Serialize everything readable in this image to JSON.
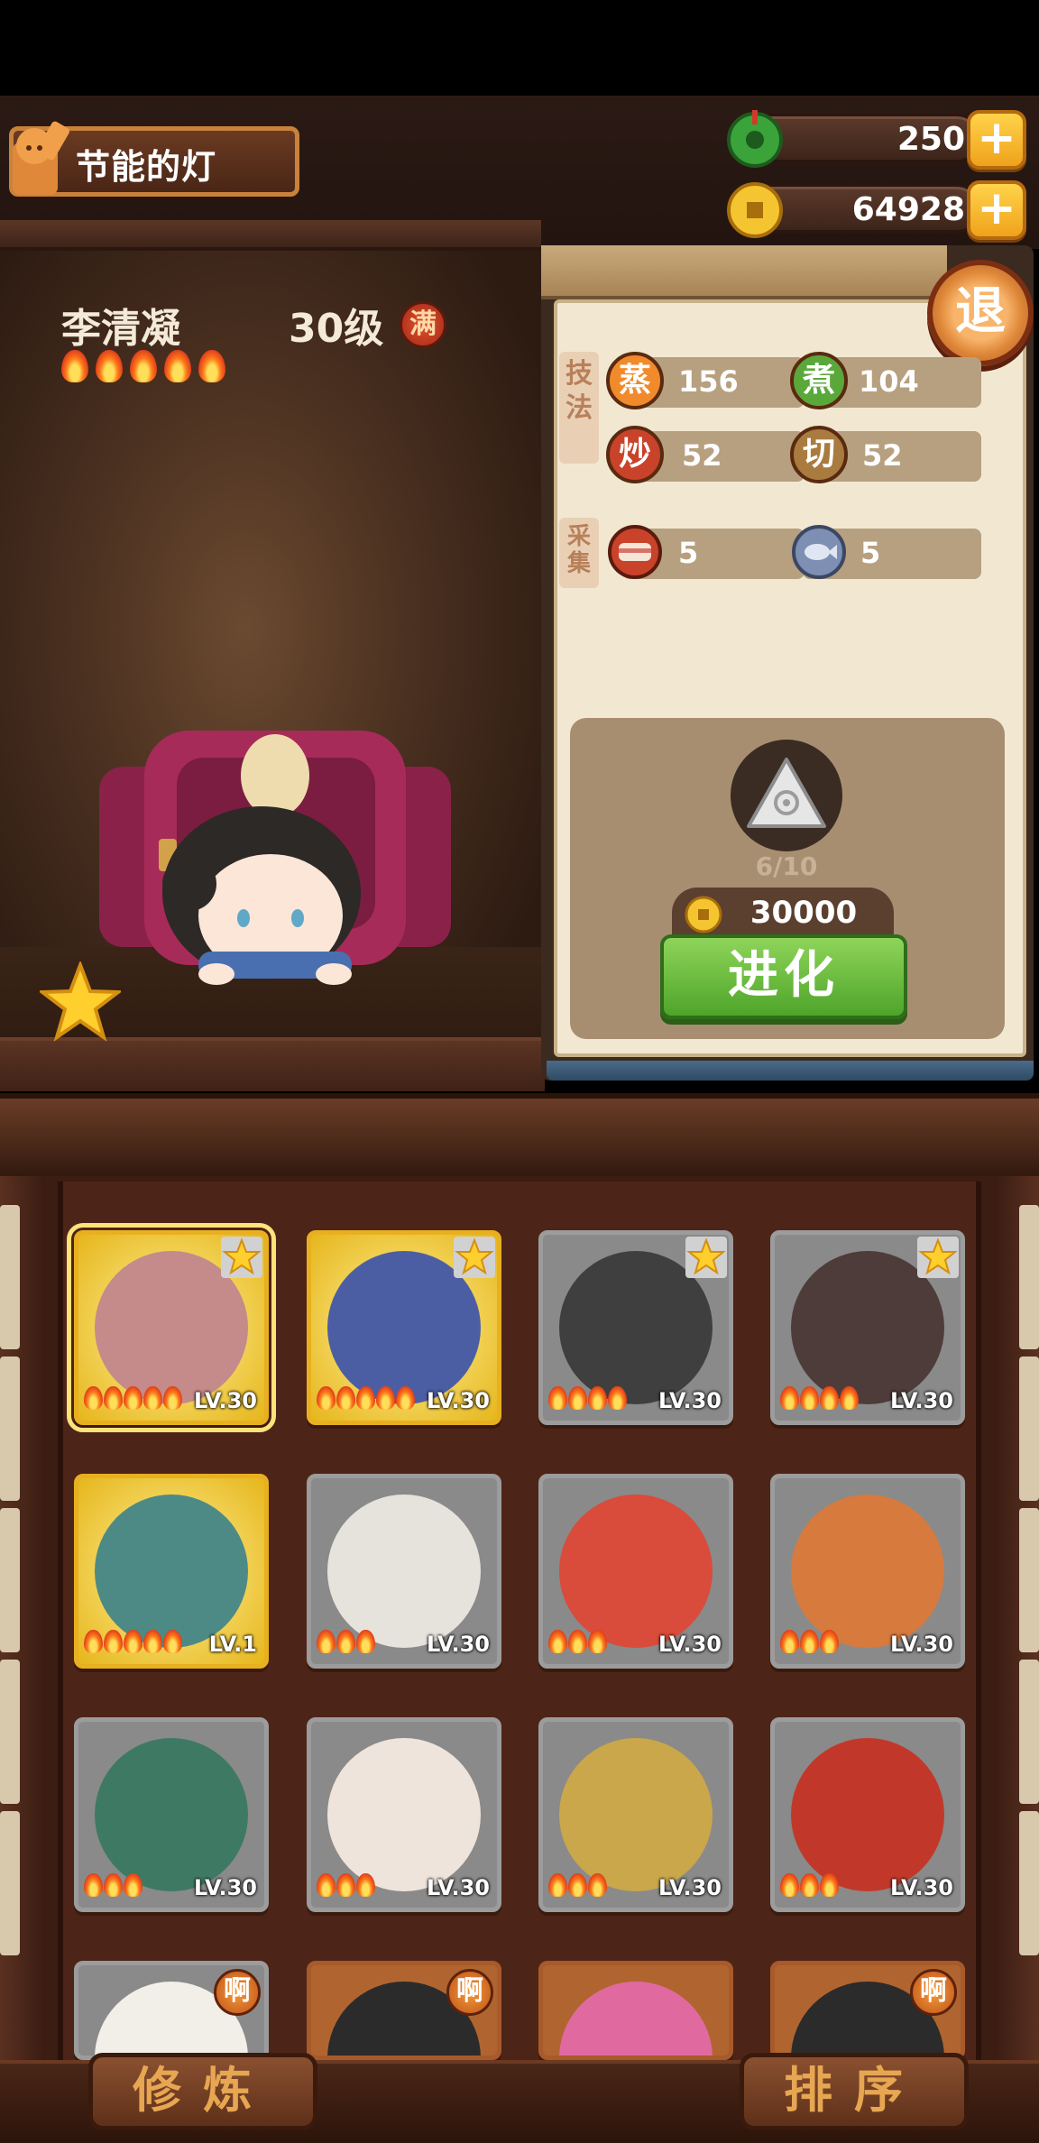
{
  "player": {
    "name": "节能的灯"
  },
  "currency": {
    "jade": {
      "value": "250",
      "add": "+"
    },
    "coins": {
      "value": "64928",
      "add": "+"
    }
  },
  "exit_label": "退",
  "character": {
    "name": "李清凝",
    "level": "30级",
    "max_badge": "满",
    "flames": 5
  },
  "stats": {
    "technique_label": "技法",
    "gather_label": "采集",
    "technique": [
      {
        "icon_label": "蒸",
        "value": "156",
        "color": "#f08a2a"
      },
      {
        "icon_label": "煮",
        "value": "104",
        "color": "#5aa83a"
      },
      {
        "icon_label": "炒",
        "value": "52",
        "color": "#c8432a"
      },
      {
        "icon_label": "切",
        "value": "52",
        "color": "#a97b3f"
      }
    ],
    "gather": [
      {
        "icon": "meat-icon",
        "value": "5"
      },
      {
        "icon": "fish-icon",
        "value": "5"
      }
    ]
  },
  "evolve": {
    "progress": "6/10",
    "cost": "30000",
    "button": "进化"
  },
  "roster": [
    {
      "level": "LV.30",
      "flames": 5,
      "style": "gold",
      "star": true,
      "selected": true,
      "art": "#c58a8a"
    },
    {
      "level": "LV.30",
      "flames": 5,
      "style": "gold",
      "star": true,
      "art": "#4c5ea3"
    },
    {
      "level": "LV.30",
      "flames": 4,
      "style": "silver",
      "star": true,
      "art": "#3f3f3f"
    },
    {
      "level": "LV.30",
      "flames": 4,
      "style": "silver",
      "star": true,
      "art": "#4e3c3a"
    },
    {
      "level": "LV.1",
      "flames": 5,
      "style": "gold",
      "art": "#4d8a86"
    },
    {
      "level": "LV.30",
      "flames": 3,
      "style": "silver",
      "art": "#e6e3dc"
    },
    {
      "level": "LV.30",
      "flames": 3,
      "style": "silver",
      "art": "#d94b3a"
    },
    {
      "level": "LV.30",
      "flames": 3,
      "style": "silver",
      "art": "#d77a3e"
    },
    {
      "level": "LV.30",
      "flames": 3,
      "style": "silver",
      "art": "#3e7a63"
    },
    {
      "level": "LV.30",
      "flames": 3,
      "style": "silver",
      "art": "#efe4dc"
    },
    {
      "level": "LV.30",
      "flames": 3,
      "style": "silver",
      "art": "#c9a74a"
    },
    {
      "level": "LV.30",
      "flames": 3,
      "style": "silver",
      "art": "#c1382a"
    },
    {
      "style": "silver",
      "badge": "啊",
      "art": "#f2efe9"
    },
    {
      "style": "orange",
      "badge": "啊",
      "art": "#2b2b2b"
    },
    {
      "style": "orange",
      "art": "#e06aa0"
    },
    {
      "style": "orange",
      "badge": "啊",
      "art": "#2b2b2b"
    }
  ],
  "bottom": {
    "train": "修炼",
    "sort": "排序"
  },
  "colors": {
    "accent_gold": "#f0a21c",
    "evolve_green": "#4ea52a",
    "wood_dark": "#3b1d12"
  }
}
